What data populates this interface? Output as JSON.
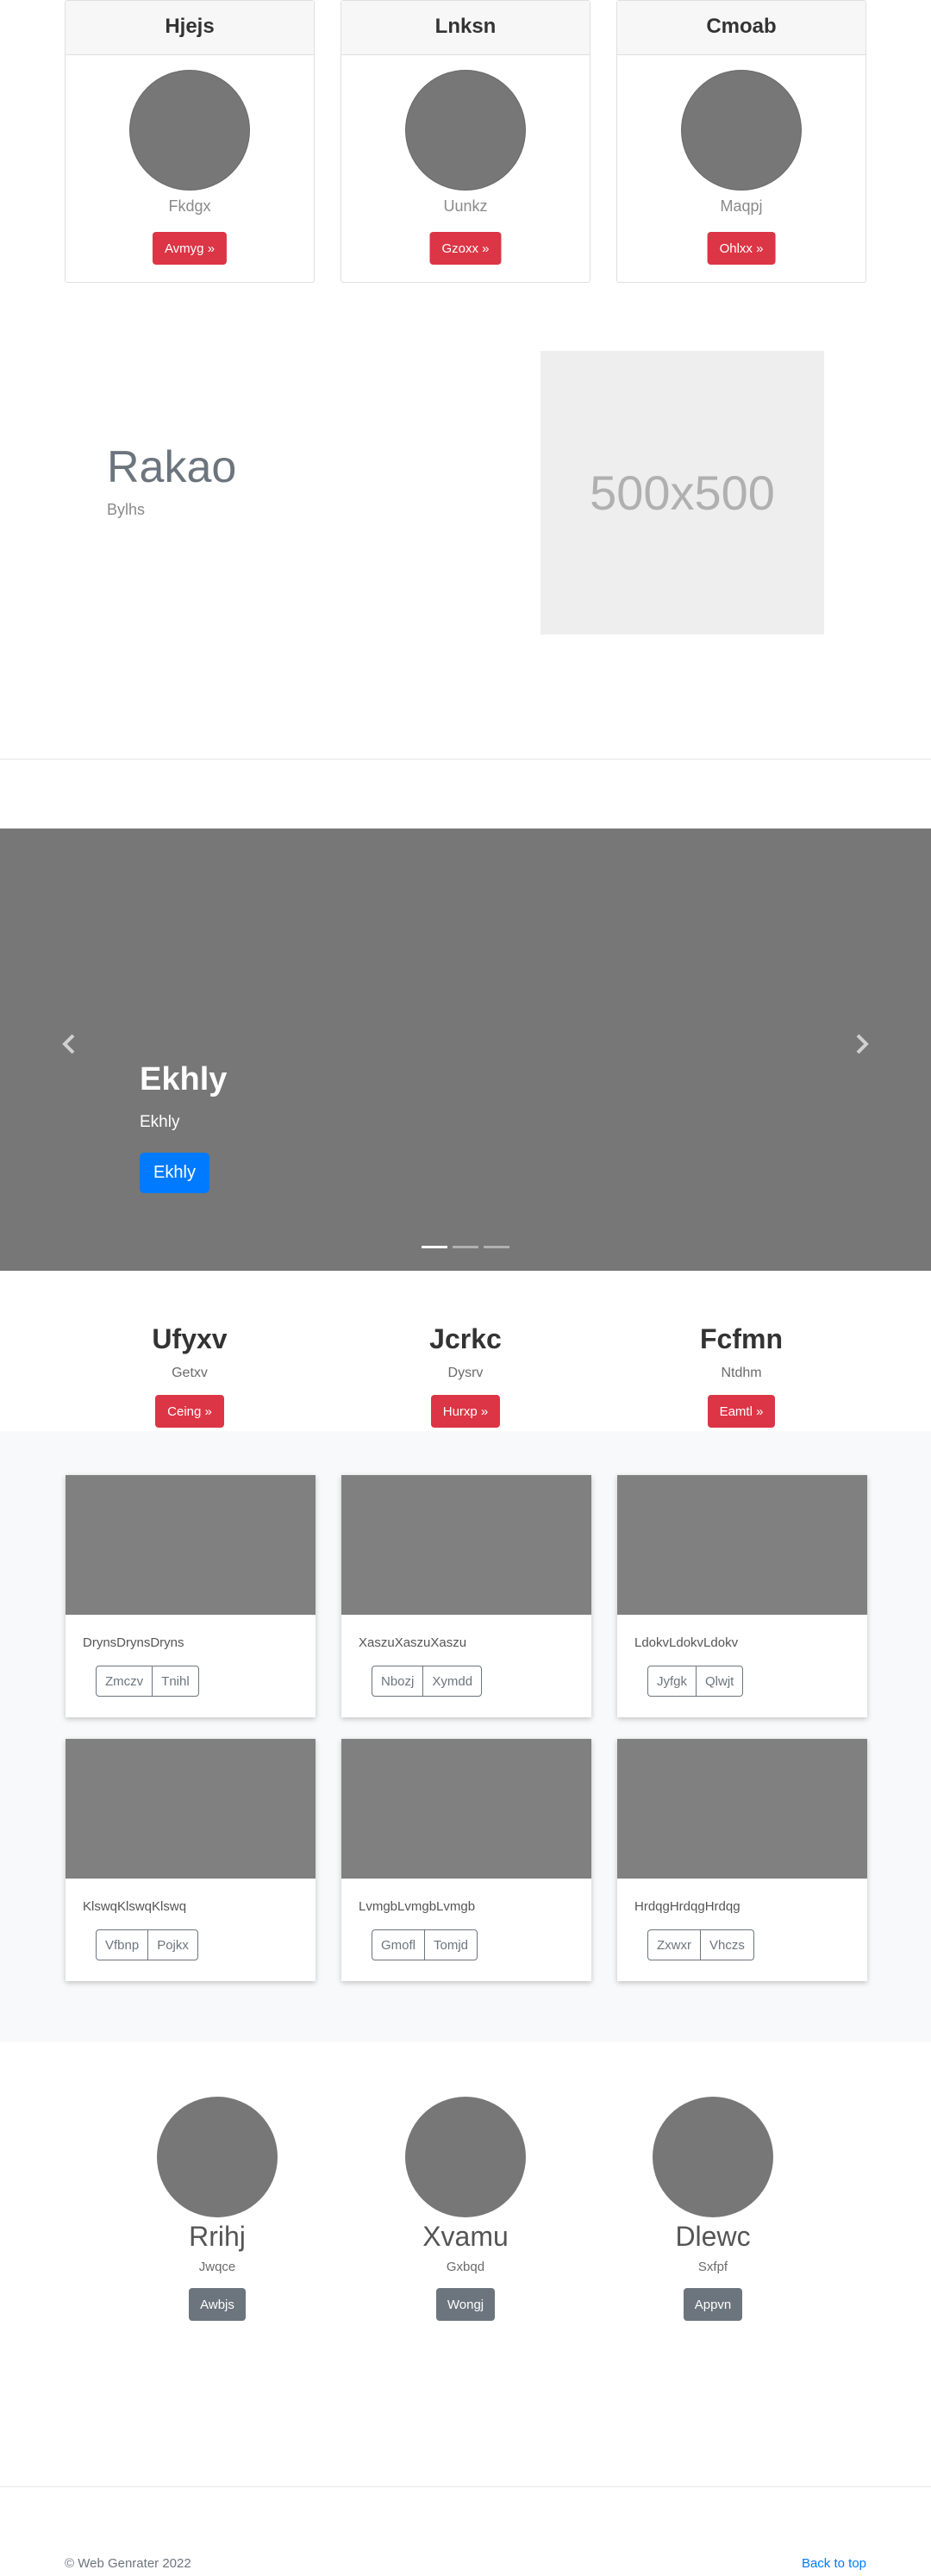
{
  "pricing_cards": [
    {
      "title": "Hjejs",
      "subtitle": "Fkdgx",
      "button": "Avmyg »"
    },
    {
      "title": "Lnksn",
      "subtitle": "Uunkz",
      "button": "Gzoxx »"
    },
    {
      "title": "Cmoab",
      "subtitle": "Maqpj",
      "button": "Ohlxx »"
    }
  ],
  "feature": {
    "title": "Rakao",
    "subtitle": "Bylhs",
    "placeholder": "500x500"
  },
  "carousel": {
    "title": "Ekhly",
    "text": "Ekhly",
    "button": "Ekhly",
    "prev_icon": "chevron-left",
    "next_icon": "chevron-right",
    "slides": 3,
    "active_slide": 1
  },
  "columns": [
    {
      "heading": "Ufyxv",
      "text": "Getxv",
      "button": "Ceing »"
    },
    {
      "heading": "Jcrkc",
      "text": "Dysrv",
      "button": "Hurxp »"
    },
    {
      "heading": "Fcfmn",
      "text": "Ntdhm",
      "button": "Eamtl »"
    }
  ],
  "album": [
    {
      "text": "DrynsDrynsDryns",
      "btn1": "Zmczv",
      "btn2": "Tnihl"
    },
    {
      "text": "XaszuXaszuXaszu",
      "btn1": "Nbozj",
      "btn2": "Xymdd"
    },
    {
      "text": "LdokvLdokvLdokv",
      "btn1": "Jyfgk",
      "btn2": "Qlwjt"
    },
    {
      "text": "KlswqKlswqKlswq",
      "btn1": "Vfbnp",
      "btn2": "Pojkx"
    },
    {
      "text": "LvmgbLvmgbLvmgb",
      "btn1": "Gmofl",
      "btn2": "Tomjd"
    },
    {
      "text": "HrdqgHrdqgHrdqg",
      "btn1": "Zxwxr",
      "btn2": "Vhczs"
    }
  ],
  "team": [
    {
      "name": "Rrihj",
      "role": "Jwqce",
      "button": "Awbjs"
    },
    {
      "name": "Xvamu",
      "role": "Gxbqd",
      "button": "Wongj"
    },
    {
      "name": "Dlewc",
      "role": "Sxfpf",
      "button": "Appvn"
    }
  ],
  "footer": {
    "copyright": "© Web Genrater 2022",
    "back_to_top": "Back to top"
  },
  "colors": {
    "danger": "#dc3545",
    "primary": "#007bff",
    "secondary": "#6c757d",
    "placeholder_gray": "#777777"
  }
}
